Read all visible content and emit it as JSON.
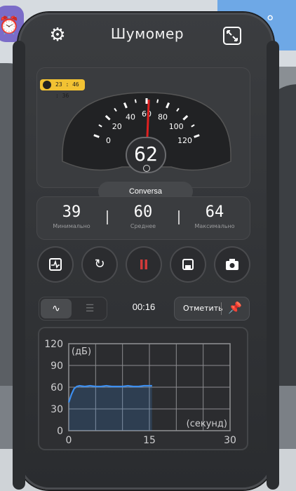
{
  "header": {
    "title": "Шумомер",
    "settings_icon": "gear-icon",
    "expand_icon": "expand-icon"
  },
  "gauge": {
    "timer": "23 : 46 : 36",
    "scale_labels": [
      "0",
      "20",
      "40",
      "60",
      "80",
      "100",
      "120"
    ],
    "reading": "62",
    "needle_value": 62,
    "mode": "Conversa"
  },
  "stats": {
    "min_value": "39",
    "min_label": "Минимально",
    "avg_value": "60",
    "avg_label": "Среднее",
    "max_value": "64",
    "max_label": "Максимально"
  },
  "controls": {
    "icons": [
      "chart-icon",
      "reset-icon",
      "pause-icon",
      "save-icon",
      "camera-icon"
    ]
  },
  "toolbar": {
    "elapsed": "00:16",
    "mark_label": "Отметить"
  },
  "chart_data": {
    "type": "line",
    "ylabel": "(дБ)",
    "xlabel": "(секунд)",
    "y_ticks": [
      "120",
      "90",
      "60",
      "30",
      "0"
    ],
    "x_ticks": [
      "0",
      "15",
      "30"
    ],
    "ylim": [
      0,
      120
    ],
    "xlim": [
      0,
      30
    ],
    "x": [
      0,
      0.5,
      1,
      1.5,
      2,
      3,
      4,
      5,
      6,
      7,
      8,
      9,
      10,
      11,
      12,
      13,
      14,
      15,
      15.5
    ],
    "y": [
      39,
      50,
      58,
      61,
      62,
      61,
      62,
      61,
      61,
      62,
      61,
      61,
      61,
      62,
      61,
      61,
      62,
      62,
      62
    ],
    "line_color": "#3d8ff0",
    "grid": true
  },
  "colors": {
    "accent": "#3d8ff0",
    "needle": "#e02020",
    "badge": "#f2c233",
    "pause": "#d23a3a"
  }
}
